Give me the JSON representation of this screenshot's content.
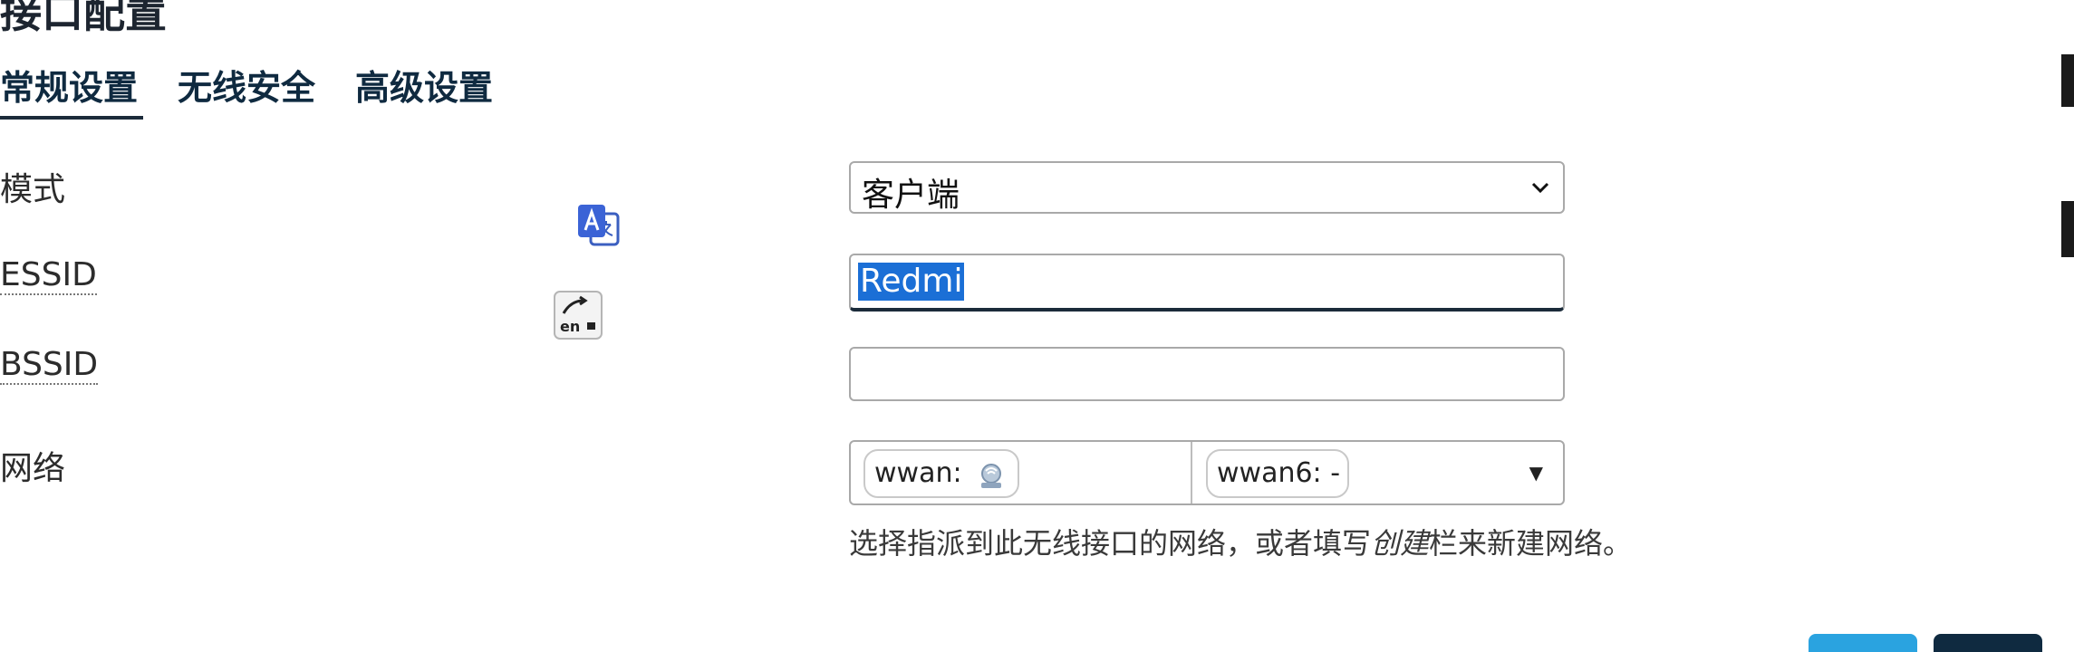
{
  "section": {
    "title": "接口配置"
  },
  "tabs": [
    {
      "label": "常规设置",
      "active": true
    },
    {
      "label": "无线安全",
      "active": false
    },
    {
      "label": "高级设置",
      "active": false
    }
  ],
  "form": {
    "mode": {
      "label": "模式",
      "value": "客户端"
    },
    "essid": {
      "label": "ESSID",
      "value": "Redmi"
    },
    "bssid": {
      "label": "BSSID",
      "value": ""
    },
    "network": {
      "label": "网络",
      "chips": [
        "wwan:",
        "wwan6: -"
      ],
      "hint_before": "选择指派到此无线接口的网络，或者填写",
      "hint_em": "创建",
      "hint_after": "栏来新建网络。"
    }
  },
  "icons": {
    "translate": "translate-icon",
    "ime": "ime-icon",
    "network_chip": "network-interface-icon",
    "chevron": "chevron-down-icon"
  },
  "colors": {
    "accent": "#0f2a40",
    "selection": "#1b6fd6",
    "primary_button": "#2aa3e0"
  }
}
